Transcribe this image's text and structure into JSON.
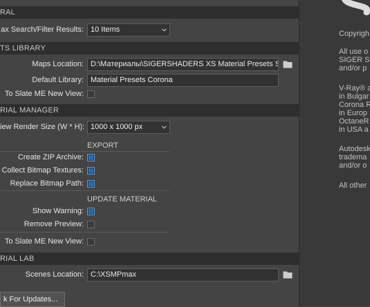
{
  "sections": {
    "general": "RAL",
    "presets_library": "TS LIBRARY",
    "material_manager": "RIAL MANAGER",
    "material_lab": "RIAL LAB"
  },
  "general": {
    "max_results_label": "ax Search/Filter Results:",
    "max_results_value": "10 Items"
  },
  "library": {
    "maps_location_label": "Maps Location:",
    "maps_location_value": "D:\\Материалы\\SIGERSHADERS XS Material Presets St",
    "default_library_label": "Default Library:",
    "default_library_value": "Material Presets Corona",
    "to_slate_label": "To Slate ME New View:"
  },
  "manager": {
    "preview_size_label": "iew Render Size (W * H):",
    "preview_size_value": "1000 x 1000 px",
    "export_heading": "EXPORT",
    "create_zip_label": "Create ZIP Archive:",
    "collect_bitmaps_label": "Collect Bitmap Textures:",
    "replace_path_label": "Replace Bitmap Path:",
    "update_heading": "UPDATE MATERIAL",
    "show_warning_label": "Show Warning:",
    "remove_preview_label": "Remove Preview:",
    "to_slate_label": "To Slate ME New View:"
  },
  "checkboxes": {
    "library_to_slate": false,
    "create_zip": true,
    "collect_bitmaps": true,
    "replace_path": true,
    "show_warning": true,
    "remove_preview": false,
    "manager_to_slate": false
  },
  "lab": {
    "scenes_location_label": "Scenes Location:",
    "scenes_location_value": "C:\\XSMPmax"
  },
  "check_updates_button": "k For Updates...",
  "about": {
    "copyright": "Copyrigh",
    "lines_1": [
      "All use o",
      "SIGER ST",
      "and/or p"
    ],
    "lines_2": [
      "V-Ray® a",
      "in Bulgar",
      "Corona R",
      "in Europ",
      "OctaneR",
      "in USA a"
    ],
    "lines_3": [
      "Autodesk",
      "tradema",
      "and/or o"
    ],
    "lines_4": [
      "All other"
    ]
  },
  "colors": {
    "panel_bg": "#444444",
    "header_bg": "#2e2e2e",
    "checkbox_on": "#1a6fc0"
  },
  "icons": [
    "chevron-down-icon",
    "folder-icon"
  ]
}
